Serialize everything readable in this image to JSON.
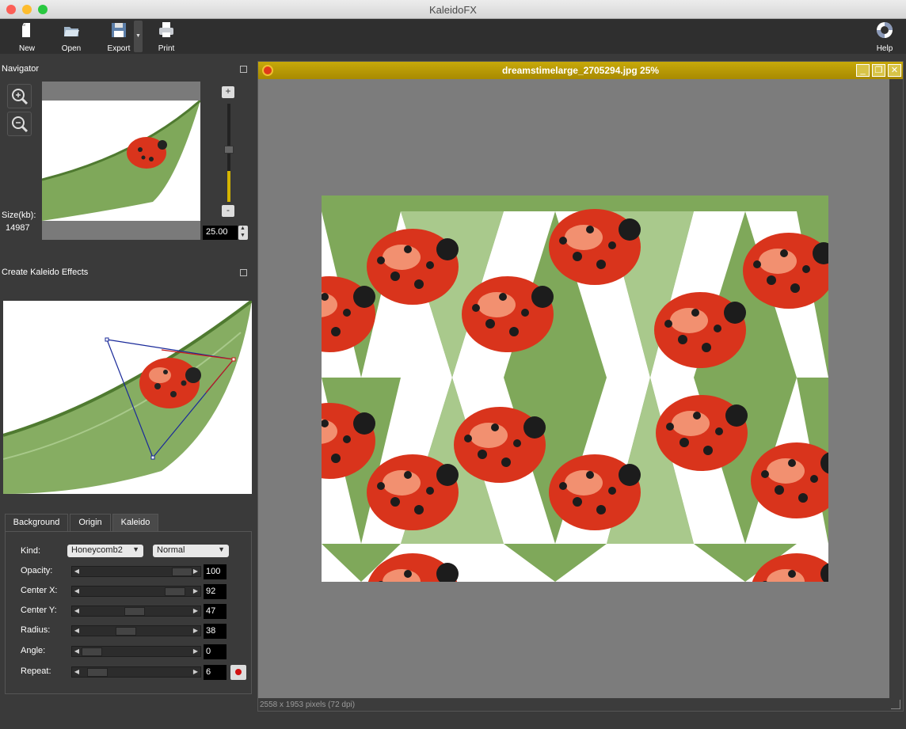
{
  "window": {
    "title": "KaleidoFX"
  },
  "toolbar": {
    "new_label": "New",
    "open_label": "Open",
    "export_label": "Export",
    "print_label": "Print",
    "help_label": "Help"
  },
  "navigator": {
    "title": "Navigator",
    "size_label": "Size(kb):",
    "size_value": "14987",
    "zoom_value": "25.00",
    "zoom_level": 0.25,
    "plus_label": "+",
    "minus_label": "-"
  },
  "kaleido_panel": {
    "title": "Create Kaleido Effects",
    "tabs": [
      {
        "label": "Background"
      },
      {
        "label": "Origin"
      },
      {
        "label": "Kaleido"
      }
    ],
    "active_tab": "Kaleido",
    "kind_label": "Kind:",
    "kind_value": "Honeycomb2",
    "blend_value": "Normal",
    "params": [
      {
        "label": "Opacity:",
        "value": "100",
        "fraction": 1.0
      },
      {
        "label": "Center X:",
        "value": "92",
        "fraction": 0.92
      },
      {
        "label": "Center Y:",
        "value": "47",
        "fraction": 0.47
      },
      {
        "label": "Radius:",
        "value": "38",
        "fraction": 0.38
      },
      {
        "label": "Angle:",
        "value": "0",
        "fraction": 0.0
      },
      {
        "label": "Repeat:",
        "value": "6",
        "fraction": 0.06
      }
    ]
  },
  "document": {
    "title": "dreamstimelarge_2705294.jpg 25%",
    "status": "2558 x 1953 pixels (72 dpi)"
  },
  "colors": {
    "doc_title_bg": "#b89a05",
    "ladybug_red": "#d9341c",
    "leaf_green": "#7fa85a"
  }
}
